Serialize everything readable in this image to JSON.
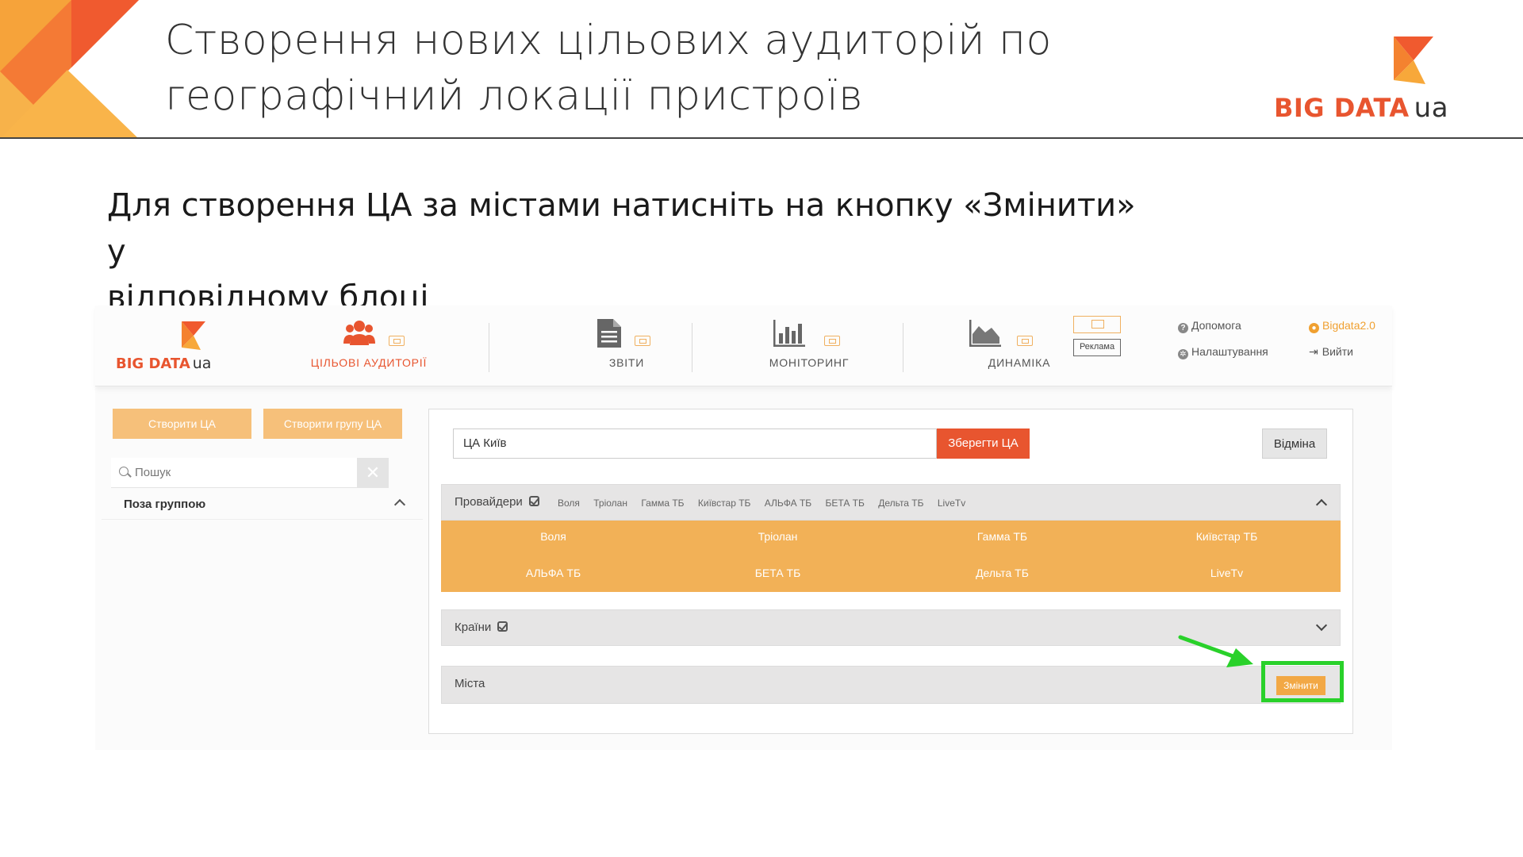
{
  "slide": {
    "title_line1": "Створення нових цільових аудиторій по",
    "title_line2": "географічний локації пристроїв",
    "brand_main": "BIG DATA",
    "brand_suffix": "ua",
    "instruction_line1": "Для створення ЦА за містами натисніть на кнопку «Змінити» у",
    "instruction_line2": "відповідному блоці"
  },
  "app": {
    "logo_main": "BIG DATA",
    "logo_suffix": "ua",
    "nav": [
      {
        "label": "ЦІЛЬОВІ АУДИТОРІЇ",
        "icon": "users-icon",
        "active": true
      },
      {
        "label": "ЗВІТИ",
        "icon": "document-icon",
        "active": false
      },
      {
        "label": "МОНІТОРИНГ",
        "icon": "bar-chart-icon",
        "active": false
      },
      {
        "label": "ДИНАМІКА",
        "icon": "area-chart-icon",
        "active": false
      }
    ],
    "ad_label": "Реклама",
    "help_label": "Допомога",
    "settings_label": "Налаштування",
    "user_label": "Bigdata2.0",
    "logout_label": "Вийти",
    "colors": {
      "accent": "#e8552f",
      "light_accent": "#f6c07a",
      "provider_bg": "#f2b157",
      "highlight": "#29d12a"
    }
  },
  "sidebar": {
    "create_ta_label": "Створити ЦА",
    "create_group_label": "Створити групу ЦА",
    "search_placeholder": "Пошук",
    "group_label": "Поза группою"
  },
  "editor": {
    "ta_name": "ЦА Київ",
    "save_label": "Зберегти ЦА",
    "cancel_label": "Відміна",
    "providers_title": "Провайдери",
    "provider_tags": [
      "Воля",
      "Тріолан",
      "Гамма ТБ",
      "Київстар ТБ",
      "АЛЬФА ТБ",
      "БЕТА ТБ",
      "Дельта ТБ",
      "LiveTv"
    ],
    "providers": [
      "Воля",
      "Тріолан",
      "Гамма ТБ",
      "Київстар ТБ",
      "АЛЬФА ТБ",
      "БЕТА ТБ",
      "Дельта ТБ",
      "LiveTv"
    ],
    "countries_title": "Країни",
    "cities_title": "Міста",
    "change_label": "Змінити"
  }
}
